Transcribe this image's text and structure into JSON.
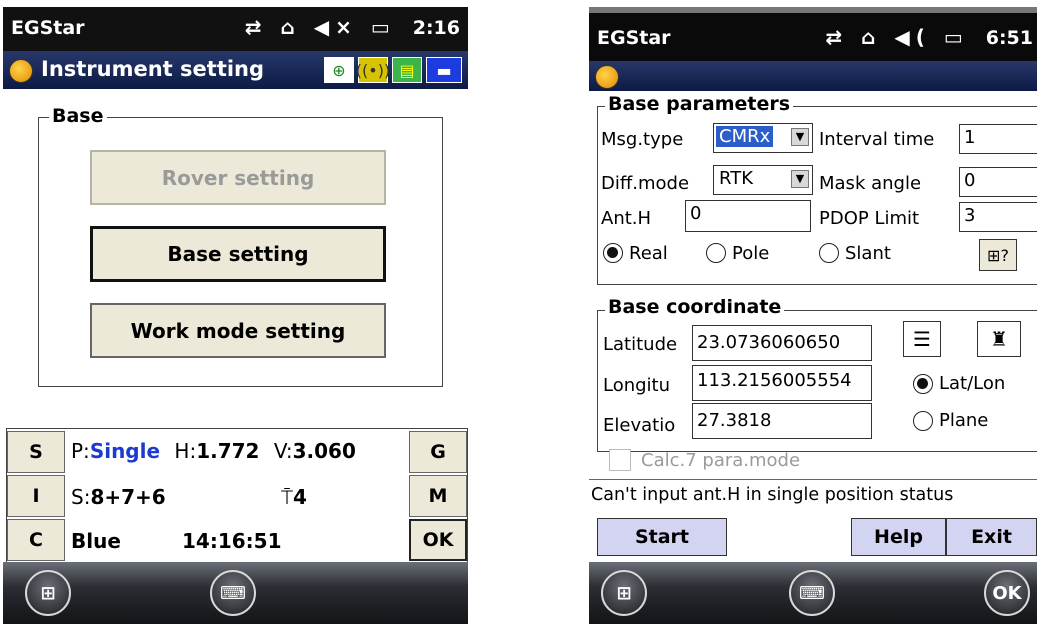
{
  "left": {
    "statusbar": {
      "app": "EGStar",
      "time": "2:16"
    },
    "title": "Instrument setting",
    "group_label": "Base",
    "buttons": {
      "rover": "Rover setting",
      "base": "Base setting",
      "workmode": "Work mode setting"
    },
    "side_buttons": {
      "s": "S",
      "i": "I",
      "c": "C",
      "g": "G",
      "m": "M",
      "ok": "OK"
    },
    "status": {
      "p_label": "P:",
      "p_value": "Single",
      "h_label": "H:",
      "h_value": "1.772",
      "v_label": "V:",
      "v_value": "3.060",
      "s_label": "S:",
      "s_value": "8+7+6",
      "antenna_count": "4",
      "link": "Blue",
      "clock": "14:16:51"
    }
  },
  "right": {
    "statusbar": {
      "app": "EGStar",
      "time": "6:51"
    },
    "base_params": {
      "label": "Base parameters",
      "msg_type_label": "Msg.type",
      "msg_type_value": "CMRx",
      "interval_label": "Interval time",
      "interval_value": "1",
      "diff_mode_label": "Diff.mode",
      "diff_mode_value": "RTK",
      "mask_label": "Mask angle",
      "mask_value": "0",
      "anth_label": "Ant.H",
      "anth_value": "0",
      "pdop_label": "PDOP Limit",
      "pdop_value": "3",
      "radio_real": "Real",
      "radio_pole": "Pole",
      "radio_slant": "Slant"
    },
    "base_coord": {
      "label": "Base coordinate",
      "lat_label": "Latitude",
      "lat_value": "23.0736060650",
      "lon_label": "Longitu",
      "lon_value": "113.2156005554",
      "elev_label": "Elevatio",
      "elev_value": "27.3818",
      "radio_latlon": "Lat/Lon",
      "radio_plane": "Plane",
      "calc_label": "Calc.7 para.mode"
    },
    "message": "Can't input ant.H in single position status",
    "buttons": {
      "start": "Start",
      "help": "Help",
      "exit": "Exit"
    },
    "taskbar_ok": "OK"
  },
  "colors": {
    "title_bar": "#1a2a5a",
    "status_blue": "#1a3ad1",
    "bottom_button": "#d3d3f2",
    "selected_blue": "#2b5ec9"
  }
}
